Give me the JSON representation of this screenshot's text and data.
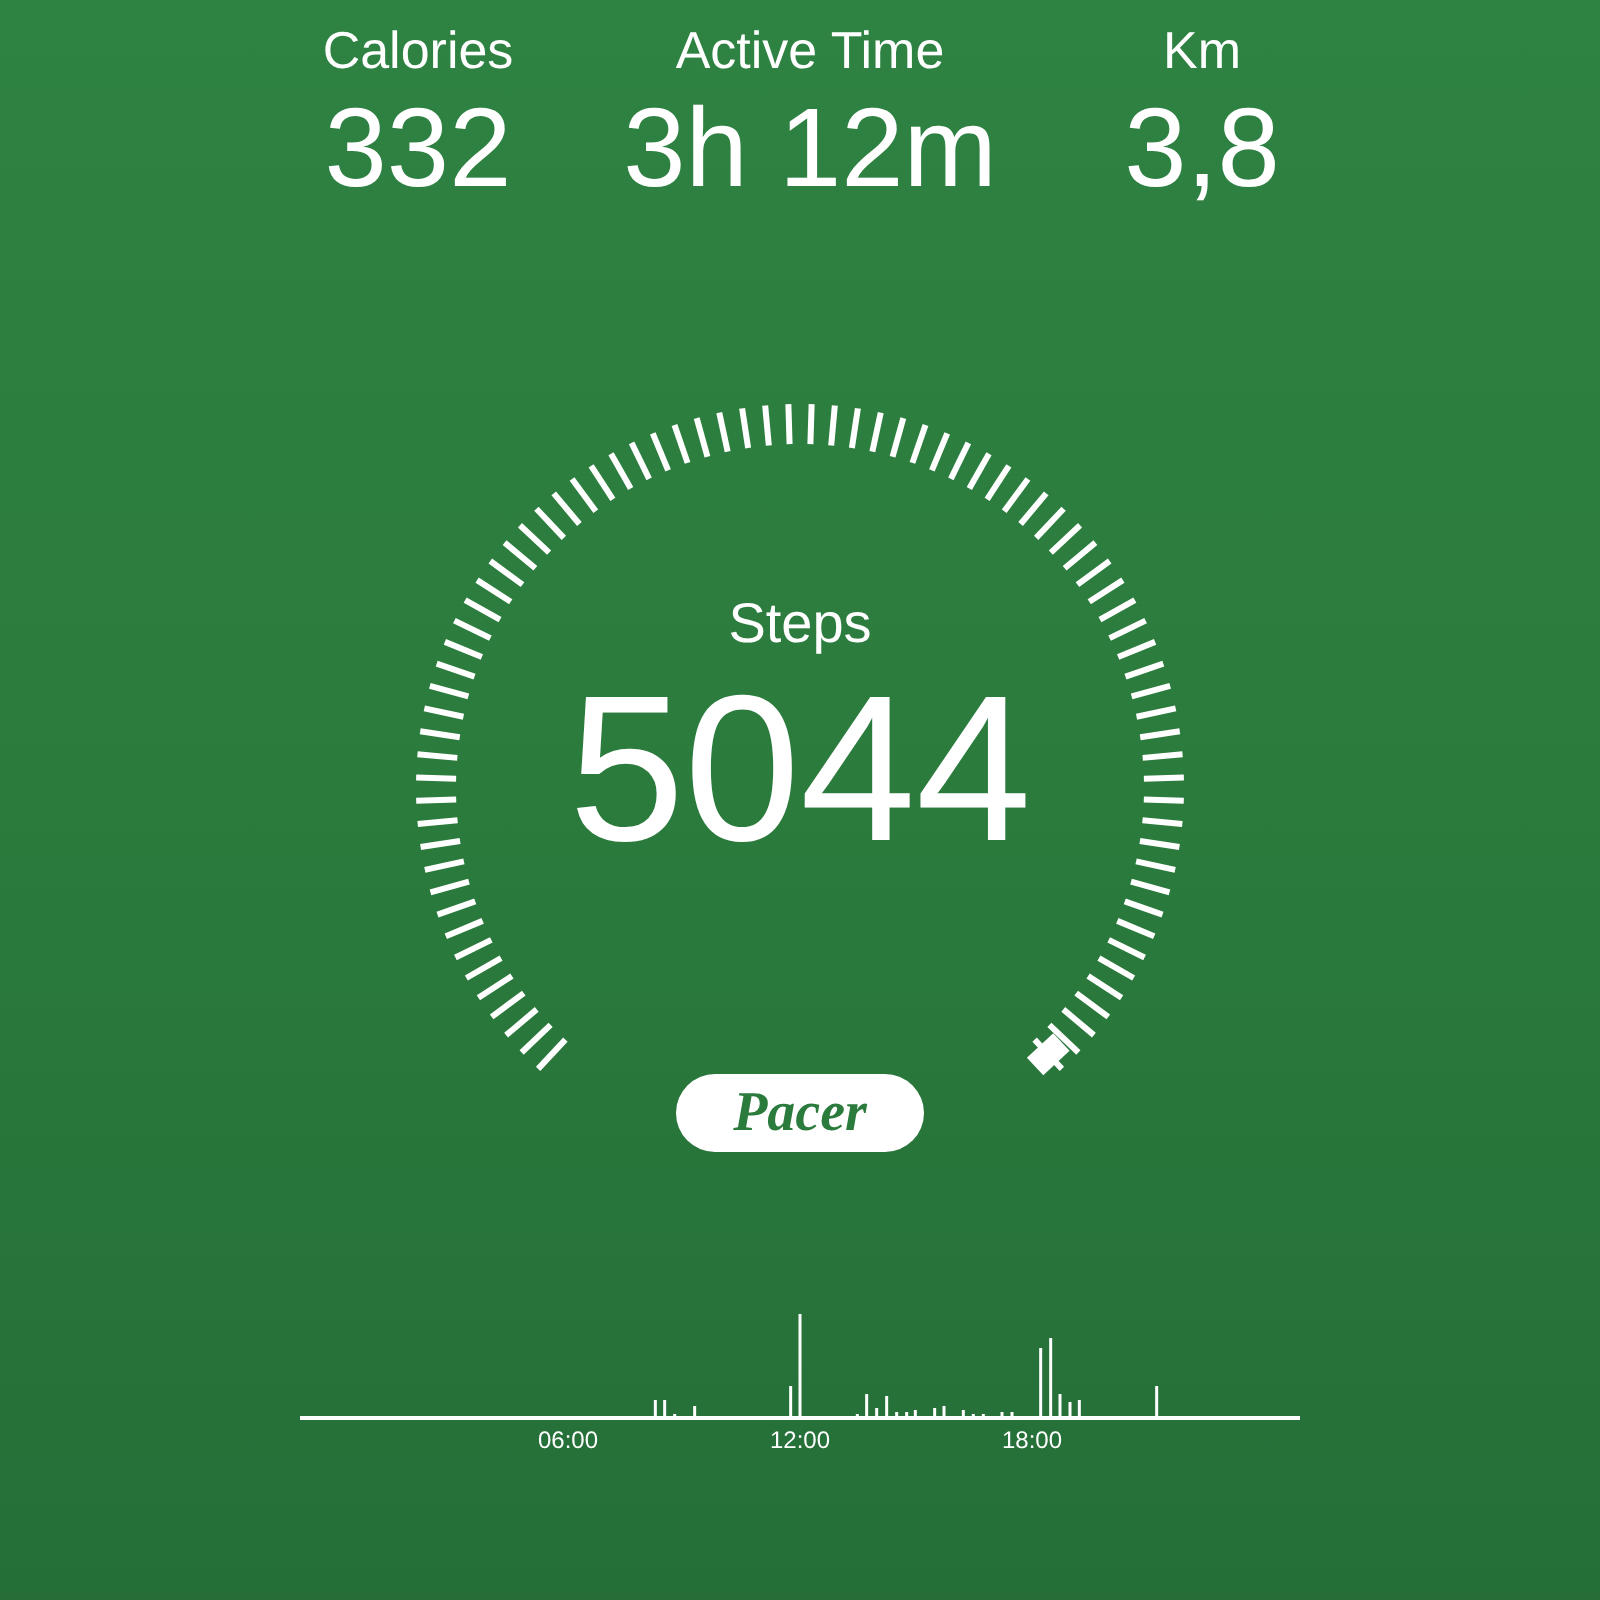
{
  "stats": [
    {
      "label": "Calories",
      "value": "332"
    },
    {
      "label": "Active Time",
      "value": "3h 12m"
    },
    {
      "label": "Km",
      "value": "3,8"
    }
  ],
  "gauge": {
    "label": "Steps",
    "value": "5044"
  },
  "badge": "Pacer",
  "timeline": {
    "time_labels": [
      "06:00",
      "12:00",
      "18:00"
    ]
  }
}
